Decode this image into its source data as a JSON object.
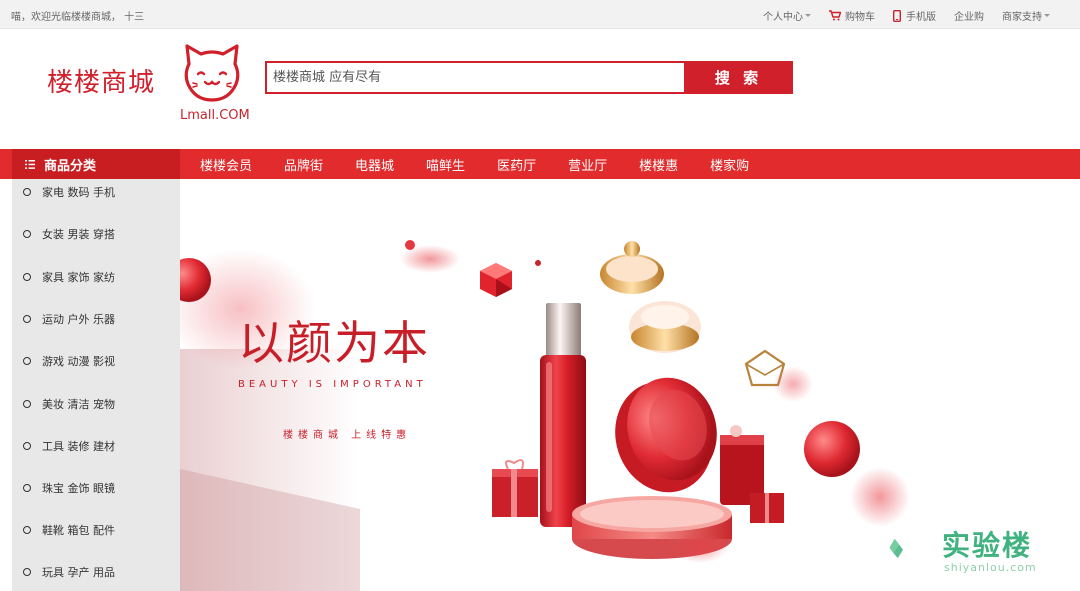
{
  "topbar": {
    "welcome": "喵，欢迎光临楼楼商城， 十三",
    "links": [
      {
        "label": "个人中心",
        "dropdown": true
      },
      {
        "label": "购物车",
        "icon": "cart-icon"
      },
      {
        "label": "手机版",
        "icon": "phone-icon"
      },
      {
        "label": "企业购"
      },
      {
        "label": "商家支持",
        "dropdown": true
      }
    ]
  },
  "header": {
    "brand": "楼楼商城",
    "logo_caption": "Lmall.COM",
    "search_placeholder": "楼楼商城 应有尽有",
    "search_button": "搜 索"
  },
  "nav": {
    "category_title": "商品分类",
    "items": [
      "楼楼会员",
      "品牌街",
      "电器城",
      "喵鲜生",
      "医药厅",
      "营业厅",
      "楼楼惠",
      "楼家购"
    ]
  },
  "sidebar": {
    "items": [
      "家电 数码 手机",
      "女装 男装 穿搭",
      "家具 家饰 家纺",
      "运动 户外 乐器",
      "游戏 动漫 影视",
      "美妆 清洁 宠物",
      "工具 装修 建材",
      "珠宝 金饰 眼镜",
      "鞋靴 箱包 配件",
      "玩具 孕产 用品"
    ]
  },
  "banner": {
    "title": "以颜为本",
    "subtitle_en": "BEAUTY IS IMPORTANT",
    "tagline": "楼楼商城  上线特惠"
  },
  "watermark": {
    "text": "实验楼",
    "url": "shiyanlou.com"
  },
  "colors": {
    "brand_red": "#d0202b",
    "nav_red": "#e22b2c",
    "watermark_green": "#3fb27f"
  }
}
